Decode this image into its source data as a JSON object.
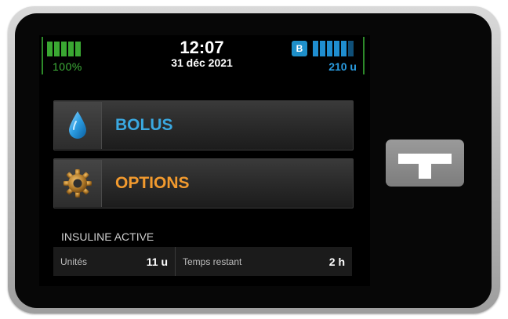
{
  "status": {
    "battery_percent": "100%",
    "time": "12:07",
    "date": "31 déc 2021",
    "insulin_badge": "B",
    "insulin_remaining": "210 u"
  },
  "menu": {
    "bolus_label": "BOLUS",
    "options_label": "OPTIONS"
  },
  "iob": {
    "title": "INSULINE ACTIVE",
    "units_label": "Unités",
    "units_value": "11 u",
    "time_label": "Temps restant",
    "time_value": "2 h"
  },
  "colors": {
    "battery": "#3aa832",
    "insulin": "#1f8ed0",
    "bolus": "#3aa8e0",
    "options": "#f29a2e"
  },
  "icons": [
    "battery-icon",
    "insulin-reservoir-icon",
    "water-drop-icon",
    "gear-icon",
    "tandem-logo"
  ]
}
